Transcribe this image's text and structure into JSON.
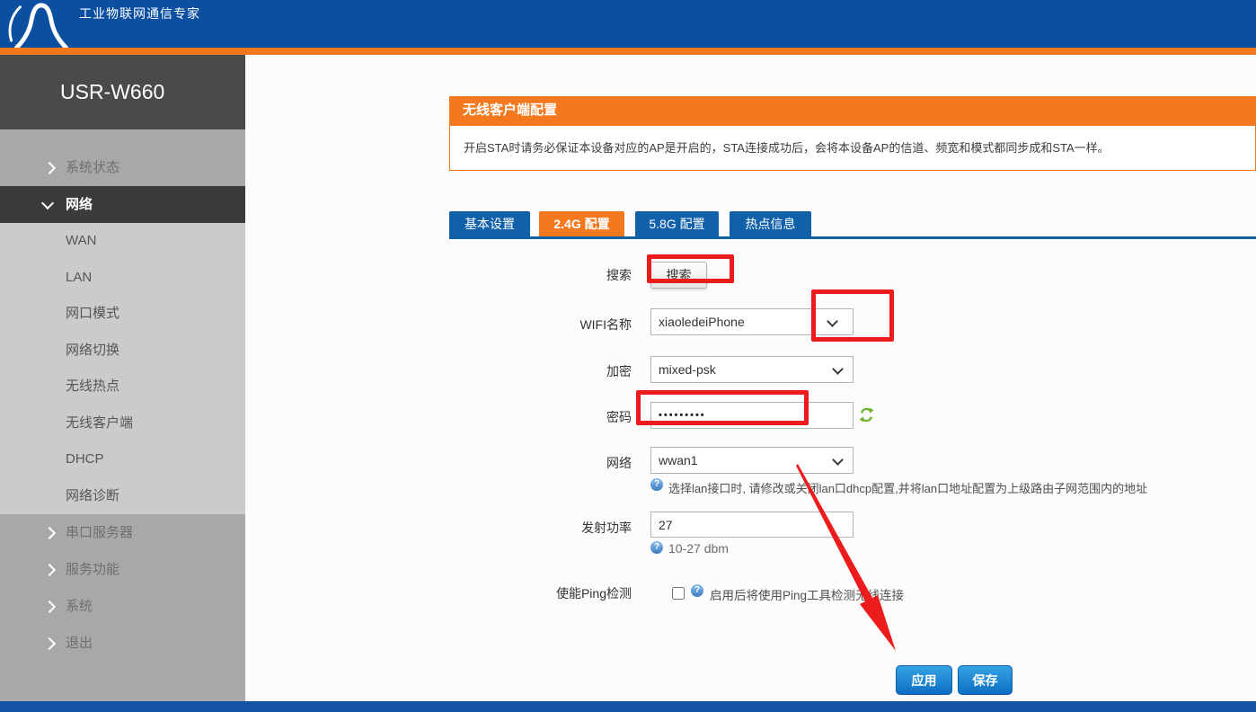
{
  "app": {
    "tagline": "工业物联网通信专家",
    "device_name": "USR-W660"
  },
  "sidebar": {
    "top_groups": [
      "系统状态"
    ],
    "active_group": "网络",
    "sub_items": [
      "WAN",
      "LAN",
      "网口模式",
      "网络切换",
      "无线热点",
      "无线客户端",
      "DHCP",
      "网络诊断"
    ],
    "bottom_groups": [
      "串口服务器",
      "服务功能",
      "系统",
      "退出"
    ]
  },
  "panel": {
    "title": "无线客户端配置",
    "note": "开启STA时请务必保证本设备对应的AP是开启的，STA连接成功后，会将本设备AP的信道、频宽和模式都同步成和STA一样。"
  },
  "tabs": [
    {
      "label": "基本设置",
      "active": false
    },
    {
      "label": "2.4G 配置",
      "active": true
    },
    {
      "label": "5.8G 配置",
      "active": false
    },
    {
      "label": "热点信息",
      "active": false
    }
  ],
  "form": {
    "search": {
      "label": "搜索",
      "button": "搜索"
    },
    "wifi_name": {
      "label": "WIFI名称",
      "value": "xiaoledeiPhone"
    },
    "encryption": {
      "label": "加密",
      "value": "mixed-psk"
    },
    "password": {
      "label": "密码",
      "masked_value": "•••••••••"
    },
    "network": {
      "label": "网络",
      "value": "wwan1",
      "help": "选择lan接口时, 请修改或关闭lan口dhcp配置,并将lan口地址配置为上级路由子网范围内的地址"
    },
    "tx_power": {
      "label": "发射功率",
      "value": "27",
      "help": "10-27 dbm"
    },
    "ping": {
      "label": "使能Ping检测",
      "checked": false,
      "help": "启用后将使用Ping工具检测无线连接"
    },
    "actions": {
      "apply": "应用",
      "save": "保存"
    }
  },
  "icons": {
    "help_glyph": "?"
  },
  "colors": {
    "brand_blue": "#0b4fa1",
    "accent_orange": "#f4791e",
    "tab_blue": "#1161aa",
    "footer_blue": "#1253a5",
    "sidebar_dark": "#4a4a49",
    "sidebar_gray": "#a8a8a8",
    "sidebar_light": "#cbcbcb",
    "sidebar_selected": "#3b3b3b",
    "annotation_red": "#ed1c1c",
    "action_button_blue": "#0d6ec2",
    "refresh_green": "#72b332"
  }
}
